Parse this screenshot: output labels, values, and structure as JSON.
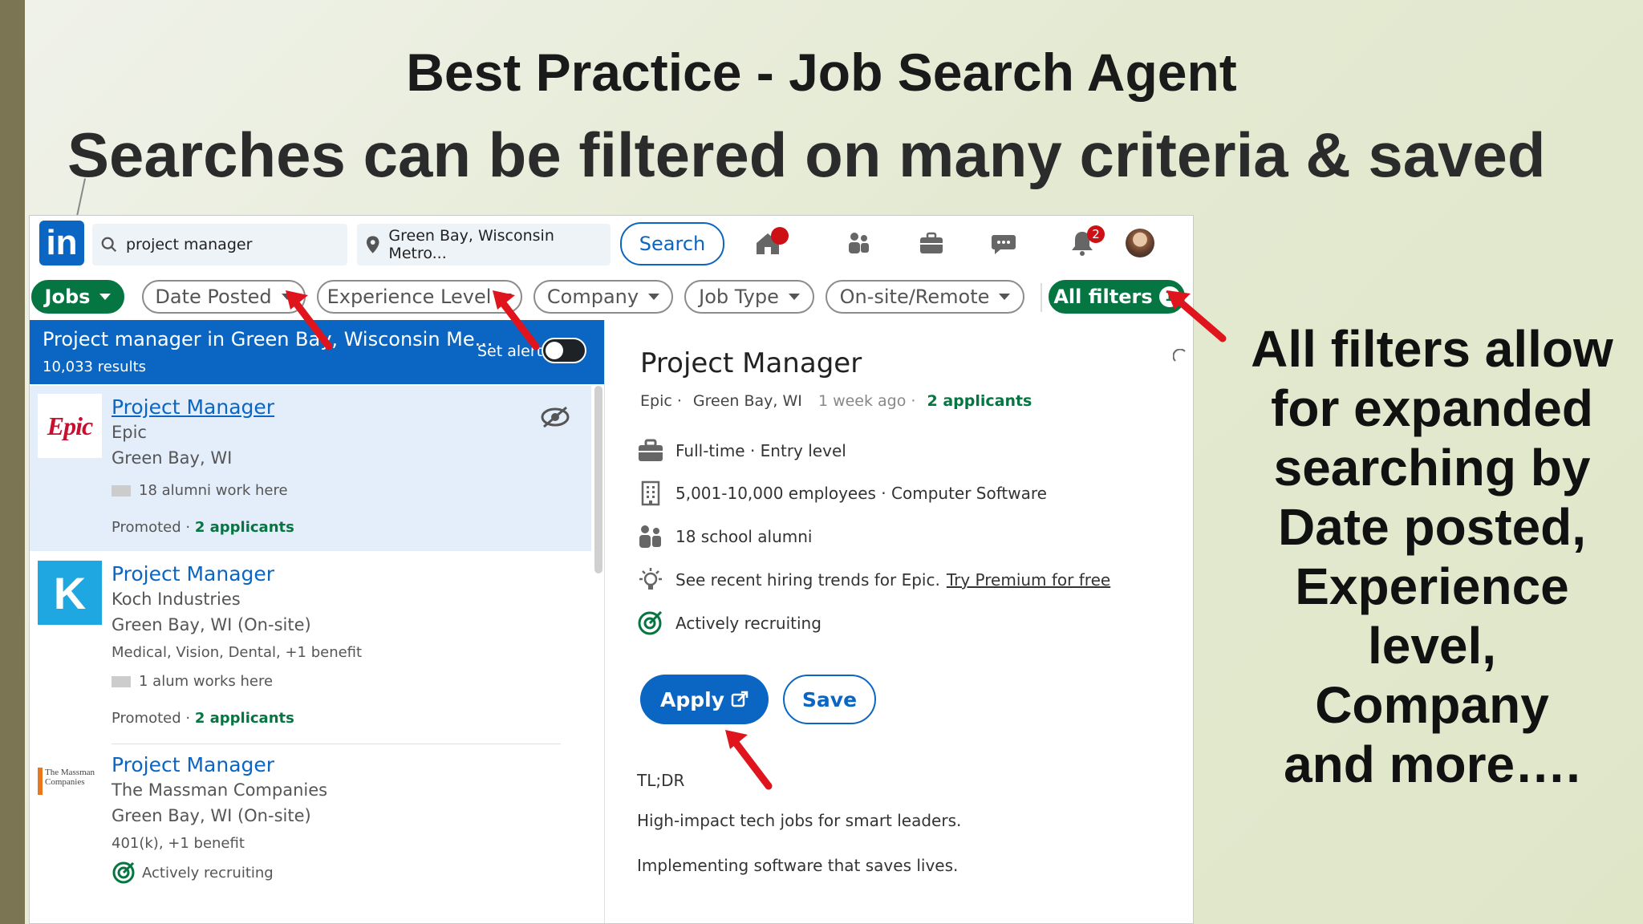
{
  "slide": {
    "title": "Best Practice - Job Search Agent",
    "subtitle": "Searches can be filtered on many criteria & saved",
    "callout_lines": [
      "All filters allow",
      "for expanded",
      "searching by",
      "Date posted,",
      "Experience",
      "level,",
      "Company",
      "and more…."
    ]
  },
  "linkedin": {
    "logo_text": "in",
    "search": {
      "keyword": "project manager",
      "location": "Green Bay, Wisconsin Metro...",
      "button": "Search"
    },
    "nav": {
      "notifications_badge": "2"
    },
    "filters": {
      "jobs": "Jobs",
      "date_posted": "Date Posted",
      "experience_level": "Experience Level",
      "company": "Company",
      "job_type": "Job Type",
      "onsite_remote": "On-site/Remote",
      "all_filters": "All filters",
      "all_filters_count": "1"
    },
    "results": {
      "title": "Project manager in Green Bay, Wisconsin Me...",
      "count": "10,033 results",
      "set_alert": "Set alert"
    },
    "jobs": [
      {
        "logo_text": "Epic",
        "title": "Project Manager",
        "company": "Epic",
        "location": "Green Bay, WI",
        "alumni": "18 alumni work here",
        "promoted": "Promoted ·",
        "applicants": "2 applicants"
      },
      {
        "logo_text": "K",
        "title": "Project Manager",
        "company": "Koch Industries",
        "location": "Green Bay, WI (On-site)",
        "benefits": "Medical, Vision, Dental, +1 benefit",
        "alumni": "1 alum works here",
        "promoted": "Promoted ·",
        "applicants": "2 applicants"
      },
      {
        "logo_text": "The Massman Companies",
        "title": "Project Manager",
        "company": "The Massman Companies",
        "location": "Green Bay, WI (On-site)",
        "benefits": "401(k), +1 benefit",
        "recruiting": "Actively recruiting"
      }
    ],
    "detail": {
      "title": "Project Manager",
      "company": "Epic ·",
      "location": "Green Bay, WI",
      "posted": "1 week ago ·",
      "applicants": "2 applicants",
      "job_type": "Full-time · Entry level",
      "company_size": "5,001-10,000 employees · Computer Software",
      "school_alumni": "18 school alumni",
      "hiring_trends": "See recent hiring trends for Epic.",
      "premium_link": "Try Premium for free",
      "recruiting": "Actively recruiting",
      "apply": "Apply",
      "save": "Save",
      "tldr": "TL;DR",
      "desc1": "High-impact tech jobs for smart leaders.",
      "desc2": "Implementing software that saves lives."
    }
  },
  "colors": {
    "linkedin_blue": "#0a66c2",
    "linkedin_green": "#057642",
    "arrow_red": "#e0141c"
  }
}
